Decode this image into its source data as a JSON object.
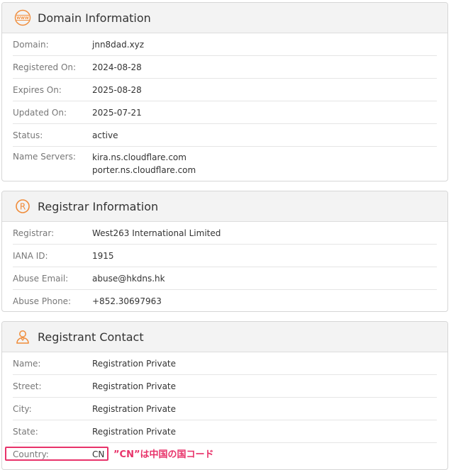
{
  "domain_info": {
    "title": "Domain Information",
    "icon": "www-globe-icon",
    "rows": [
      {
        "label": "Domain:",
        "value": "jnn8dad.xyz"
      },
      {
        "label": "Registered On:",
        "value": "2024-08-28"
      },
      {
        "label": "Expires On:",
        "value": "2025-08-28"
      },
      {
        "label": "Updated On:",
        "value": "2025-07-21"
      },
      {
        "label": "Status:",
        "value": "active"
      }
    ],
    "name_servers_label": "Name Servers:",
    "name_servers": [
      "kira.ns.cloudflare.com",
      "porter.ns.cloudflare.com"
    ]
  },
  "registrar_info": {
    "title": "Registrar Information",
    "icon": "registered-icon",
    "rows": [
      {
        "label": "Registrar:",
        "value": "West263 International Limited"
      },
      {
        "label": "IANA ID:",
        "value": "1915"
      },
      {
        "label": "Abuse Email:",
        "value": "abuse@hkdns.hk"
      },
      {
        "label": "Abuse Phone:",
        "value": "+852.30697963"
      }
    ]
  },
  "registrant_contact": {
    "title": "Registrant Contact",
    "icon": "person-icon",
    "rows": [
      {
        "label": "Name:",
        "value": "Registration Private"
      },
      {
        "label": "Street:",
        "value": "Registration Private"
      },
      {
        "label": "City:",
        "value": "Registration Private"
      },
      {
        "label": "State:",
        "value": "Registration Private"
      },
      {
        "label": "Country:",
        "value": "CN"
      }
    ]
  },
  "annotation": {
    "text": "”CN”は中国の国コード",
    "color": "#e8336a"
  },
  "colors": {
    "accent_orange": "#f08c3a",
    "highlight_pink": "#e8336a"
  }
}
